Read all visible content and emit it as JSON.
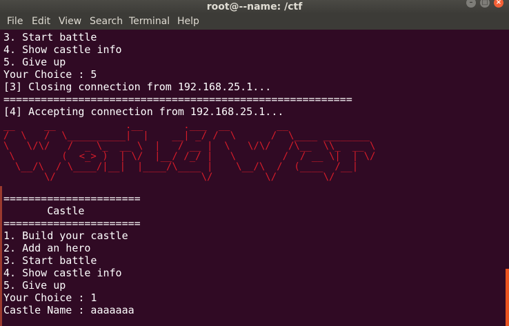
{
  "window": {
    "title": "root@--name: /ctf"
  },
  "menu": [
    "File",
    "Edit",
    "View",
    "Search",
    "Terminal",
    "Help"
  ],
  "terminal": {
    "lines": [
      "3. Start battle",
      "4. Show castle info",
      "5. Give up",
      "Your Choice : 5",
      "[3] Closing connection from 192.168.25.1...",
      "========================================================",
      "[4] Accepting connection from 192.168.25.1..."
    ],
    "banner": "__     __            .__       .___  __        __\n/  \\   /  \\__________|  |    __| _/ /  \\      /  \\____ ________\n\\   \\/\\/   /  _ \\_  __ \\  |   / __ |  \\   \\/\\/   /\\__  \\\\_  __ \\\n \\        (  <_> )  | \\/  |__/ /_/ |   \\        /  / __ \\|  | \\/\n  \\__/\\  / \\____/|__|  |____/\\____ |    \\__/\\  /  (____  /__|\n       \\/                         \\/         \\/        \\/",
    "menu_lines": [
      "======================",
      "       Castle",
      "======================",
      "1. Build your castle",
      "2. Add an hero",
      "3. Start battle",
      "4. Show castle info",
      "5. Give up",
      "Your Choice : 1",
      "Castle Name : aaaaaaa"
    ]
  },
  "colors": {
    "terminal_bg": "#300a24",
    "text": "#ffffff",
    "banner": "#d81d2a",
    "titlebar": "#3c3b37"
  }
}
